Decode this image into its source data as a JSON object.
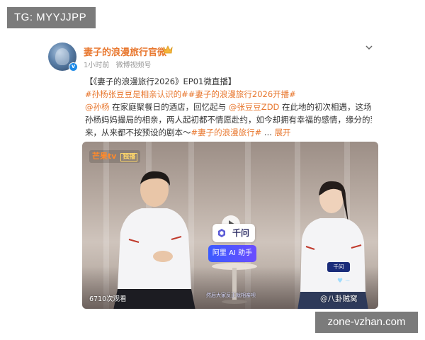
{
  "watermarks": {
    "top": "TG: MYYJJPP",
    "bottom": "zone-vzhan.com"
  },
  "post": {
    "account_name": "妻子的浪漫旅行官微",
    "time": "1小时前",
    "source": "微博视频号",
    "lines": [
      [
        {
          "t": "plain",
          "v": "【《妻子的浪漫旅行2026》EP01微直播】"
        }
      ],
      [
        {
          "t": "tag",
          "v": "#孙杨张豆豆是相亲认识的##妻子的浪漫旅行2026开播#"
        }
      ],
      [
        {
          "t": "mention",
          "v": "@孙杨"
        },
        {
          "t": "plain",
          "v": " 在家庭聚餐日的酒店，回忆起与 "
        },
        {
          "t": "mention",
          "v": "@张豆豆ZDD"
        },
        {
          "t": "plain",
          "v": " 在此地的初次相遇，这场由"
        }
      ],
      [
        {
          "t": "plain",
          "v": "孙杨妈妈撮局的相亲，两人起初都不情愿赴约，如今却拥有幸福的感情，缘分的到"
        }
      ],
      [
        {
          "t": "plain",
          "v": "来，从来都不按预设的剧本～"
        },
        {
          "t": "tag",
          "v": "#妻子的浪漫旅行#"
        },
        {
          "t": "plain",
          "v": "  ... "
        },
        {
          "t": "expand",
          "v": "展开"
        }
      ]
    ]
  },
  "video": {
    "channel_logo": "芒果tv",
    "channel_tag": "独播",
    "qwen_label": "千问",
    "ali_button": "阿里 AI 助手",
    "mini_badge": "千问",
    "caption": "然后大家反正就相亲呗",
    "view_count": "6710次观看",
    "corner_logo": "@八卦贼窝"
  },
  "colors": {
    "accent": "#e8772e",
    "watermark_bg": "#7b7b7b"
  }
}
